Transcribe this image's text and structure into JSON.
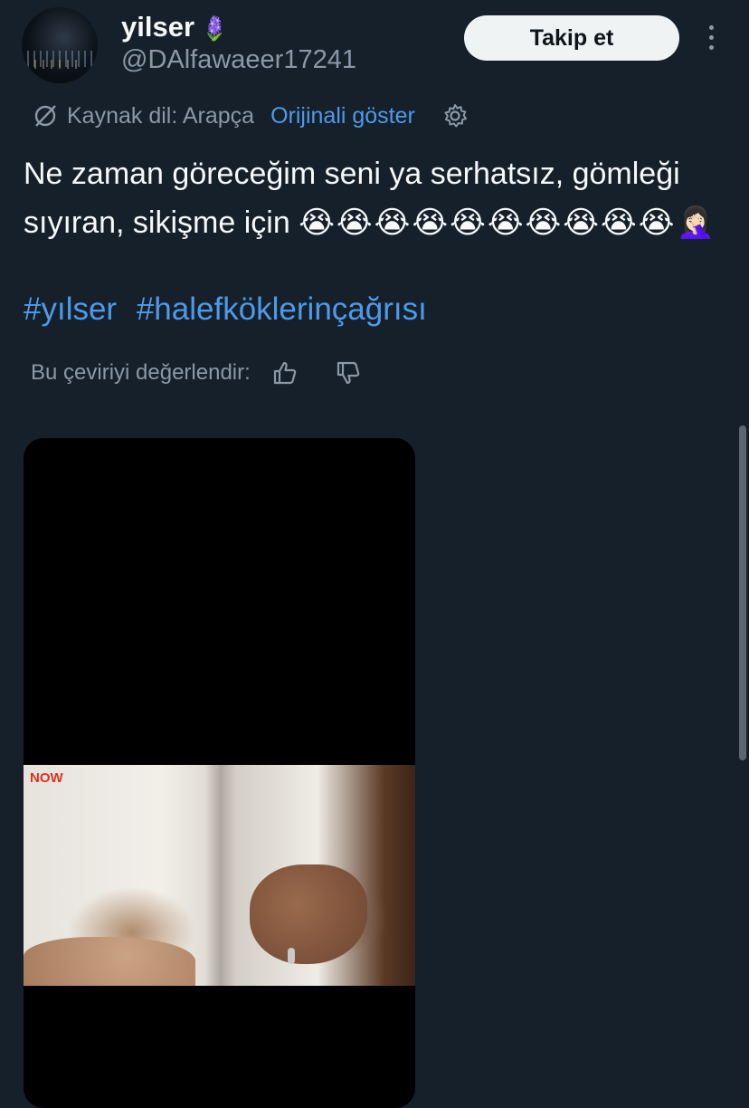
{
  "author": {
    "display_name": "yilser",
    "name_emoji": "🪻",
    "handle": "@DAlfawaeer17241"
  },
  "follow_button": {
    "label": "Takip et"
  },
  "translation": {
    "source_label": "Kaynak dil: Arapça",
    "show_original": "Orijinali göster"
  },
  "tweet": {
    "text": "Ne zaman göreceğim seni ya serhatsız, gömleği sıyıran, sikişme için ",
    "emojis": "😭😭😭😭😭😭😭😭😭😭🤦🏻‍♀️",
    "hashtags": [
      "#yılser",
      "#halefköklerinçağrısı"
    ]
  },
  "rating": {
    "label": "Bu çeviriyi değerlendir:"
  },
  "media": {
    "watermark": "NOW"
  },
  "colors": {
    "background": "#15202b",
    "accent": "#4f9ae8",
    "secondary_text": "#8b98a5",
    "follow_button_bg": "#eff3f4"
  }
}
